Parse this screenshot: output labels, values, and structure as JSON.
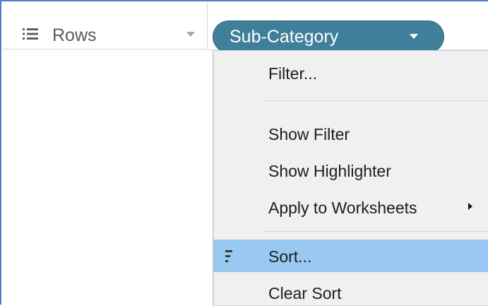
{
  "shelf": {
    "label": "Rows",
    "icon": "rows-list-icon",
    "dropdown_icon": "chevron-down-icon"
  },
  "pill": {
    "label": "Sub-Category",
    "dropdown_icon": "chevron-down-icon",
    "color": "#3f7f9a"
  },
  "menu": {
    "items": [
      {
        "label": "Filter...",
        "has_submenu": false,
        "highlighted": false
      },
      {
        "label": "Show Filter",
        "has_submenu": false,
        "highlighted": false
      },
      {
        "label": "Show Highlighter",
        "has_submenu": false,
        "highlighted": false
      },
      {
        "label": "Apply to Worksheets",
        "has_submenu": true,
        "highlighted": false
      },
      {
        "label": "Sort...",
        "has_submenu": false,
        "highlighted": true,
        "icon": "sort-icon"
      },
      {
        "label": "Clear Sort",
        "has_submenu": false,
        "highlighted": false
      }
    ],
    "highlight_color": "#99c9f2"
  }
}
